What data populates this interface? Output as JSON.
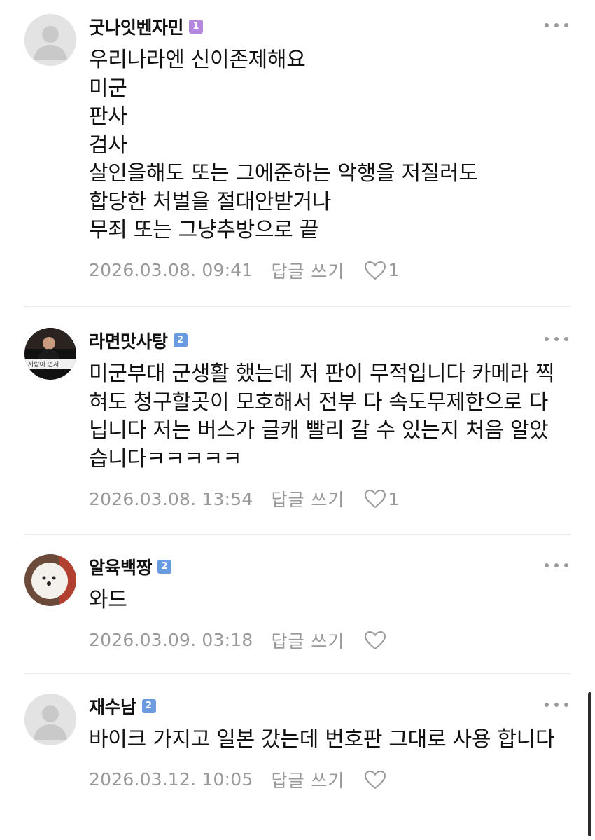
{
  "comments": [
    {
      "nickname": "굿나잇벤자민",
      "level": "1",
      "level_color": "#b388dd",
      "avatar": "default-avatar",
      "text": "우리나라엔 신이존제해요\n미군\n판사\n검사\n살인을해도 또는 그에준하는 악행을 저질러도\n합당한 처벌을 절대안받거나\n무죄 또는 그냥추방으로 끝",
      "date": "2026.03.08. 09:41",
      "reply_label": "답글 쓰기",
      "likes": "1"
    },
    {
      "nickname": "라면맛사탕",
      "level": "2",
      "level_color": "#6a9be0",
      "avatar": "photo-avatar-man",
      "text": "미군부대 군생활 했는데 저 판이 무적입니다 카메라 찍혀도 청구할곳이 모호해서 전부 다 속도무제한으로 다닙니다 저는 버스가 글캐 빨리 갈 수 있는지 처음 알았습니다ㅋㅋㅋㅋㅋ",
      "date": "2026.03.08. 13:54",
      "reply_label": "답글 쓰기",
      "likes": "1"
    },
    {
      "nickname": "알육백짱",
      "level": "2",
      "level_color": "#6a9be0",
      "avatar": "photo-avatar-dog",
      "text": "와드",
      "date": "2026.03.09. 03:18",
      "reply_label": "답글 쓰기",
      "likes": ""
    },
    {
      "nickname": "재수남",
      "level": "2",
      "level_color": "#6a9be0",
      "avatar": "default-avatar",
      "text": "바이크 가지고 일본 갔는데 번호판 그대로 사용 합니다",
      "date": "2026.03.12. 10:05",
      "reply_label": "답글 쓰기",
      "likes": ""
    }
  ],
  "colors": {
    "meta_text": "#999999",
    "divider": "#ececec",
    "body_text": "#111111"
  }
}
